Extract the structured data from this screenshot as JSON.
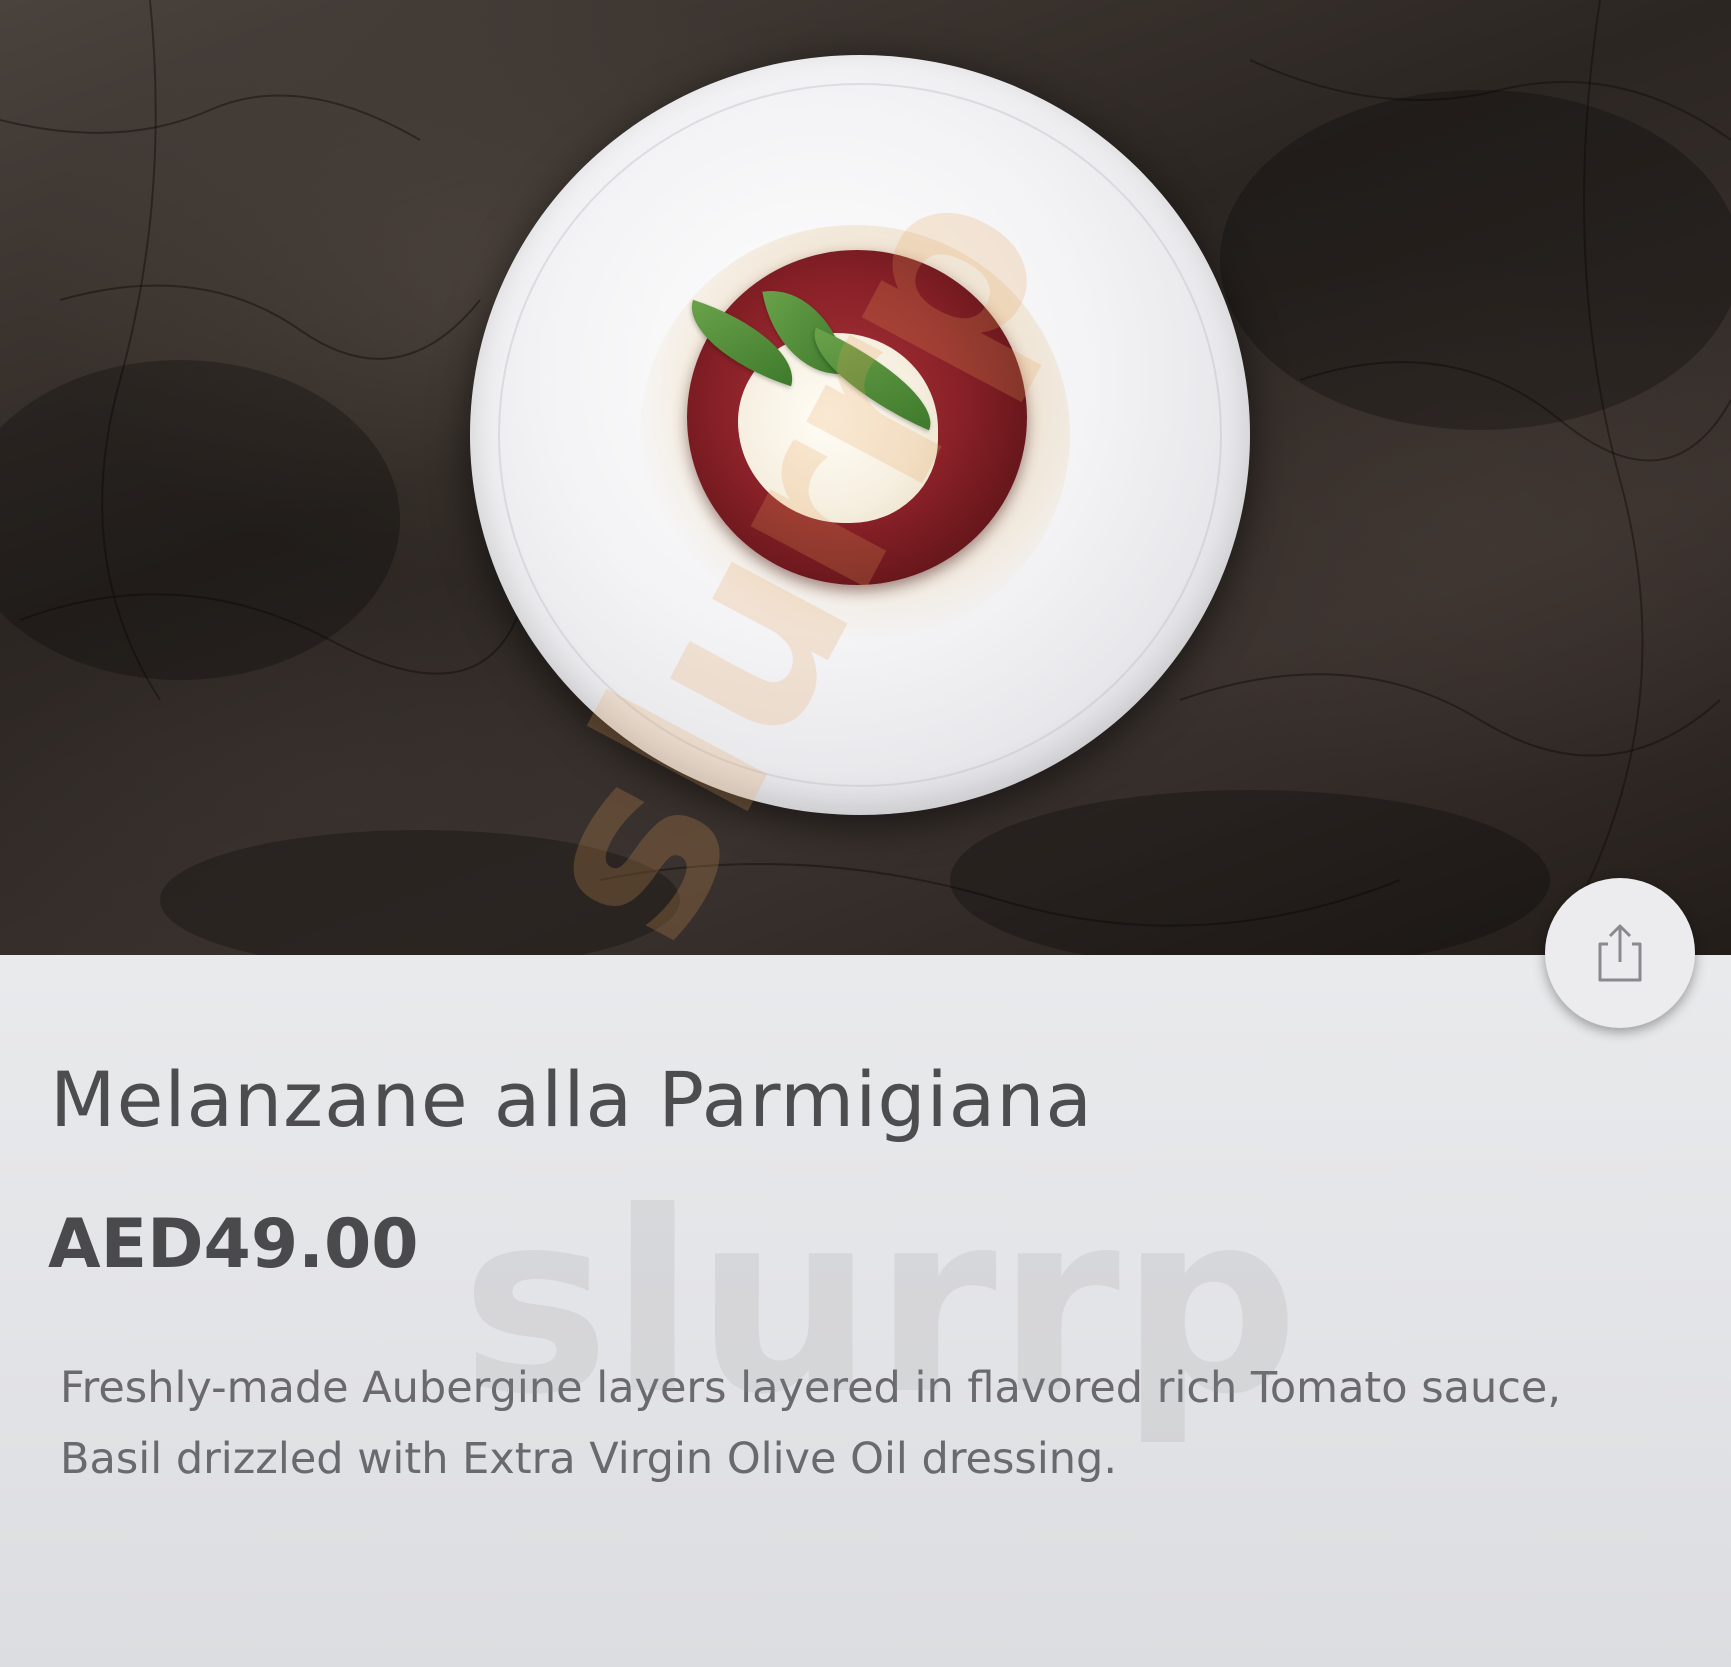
{
  "dish": {
    "name": "Melanzane alla Parmigiana",
    "price": "AED49.00",
    "description": "Freshly-made Aubergine layers layered in flavored rich Tomato sauce, Basil drizzled with Extra Virgin Olive Oil dressing."
  },
  "share": {
    "icon": "share-icon"
  },
  "watermark": {
    "text": "slurrp",
    "color": "#e8a25a"
  },
  "colors": {
    "title": "#4d4d50",
    "price": "#4a4a4d",
    "description": "#6a6a6e",
    "card_background": "#e6e7e9"
  }
}
